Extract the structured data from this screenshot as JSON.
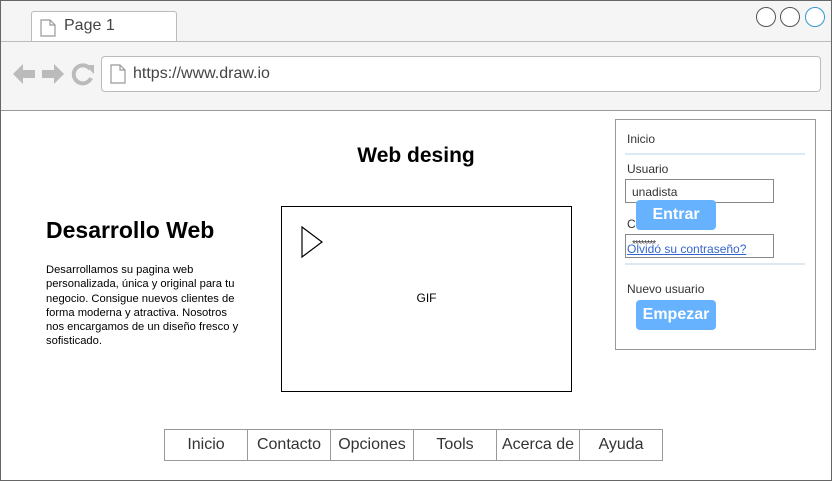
{
  "browser": {
    "tab_title": "Page 1",
    "url": "https://www.draw.io",
    "icons": [
      "back-arrow-icon",
      "forward-arrow-icon",
      "reload-icon",
      "page-icon"
    ]
  },
  "page": {
    "title": "Web desing",
    "hero_title": "Desarrollo Web",
    "hero_text": "Desarrollamos su pagina web personalizada, única y original para tu negocio. Consigue nuevos clientes de forma moderna y atractiva. Nosotros nos encargamos de un diseño fresco y sofisticado.",
    "media_label": "GIF"
  },
  "login": {
    "heading": "Inicio",
    "user_label": "Usuario",
    "user_value": "unadista",
    "password_label_partial": "C",
    "password_value": "********",
    "login_button": "Entrar",
    "forgot_link": "Olvidó su contraseño?",
    "new_user_label": "Nuevo usuario",
    "signup_button": "Empezar"
  },
  "footer_menu": [
    "Inicio",
    "Contacto",
    "Opciones",
    "Tools",
    "Acerca de",
    "Ayuda"
  ],
  "colors": {
    "accent": "#66b2ff",
    "link": "#3366cc",
    "window_button_active": "#3399cc"
  }
}
